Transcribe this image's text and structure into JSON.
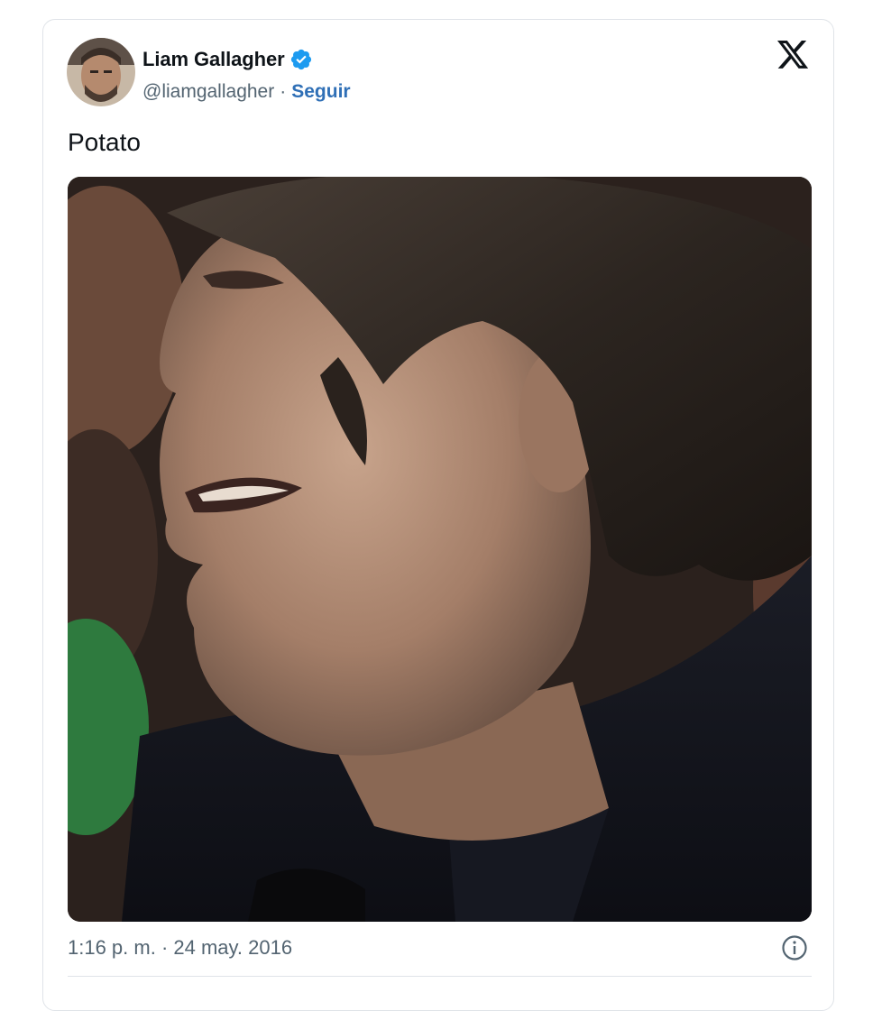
{
  "tweet": {
    "author": {
      "name": "Liam Gallagher",
      "handle": "@liamgallagher",
      "separator": "·",
      "follow_label": "Seguir",
      "verified": true,
      "avatar_icon": "avatar-photo"
    },
    "text": "Potato",
    "media": {
      "type": "photo",
      "icon": "photo-of-man-in-profile"
    },
    "timestamp": "1:16 p. m. · 24 may. 2016",
    "icons": {
      "platform_logo": "x-logo-icon",
      "verified": "verified-badge-icon",
      "info": "info-icon"
    }
  },
  "colors": {
    "text_primary": "#0f1419",
    "text_secondary": "#536471",
    "link": "#2f6fb6",
    "verified_badge": "#1d9bf0",
    "border": "#dfe3e8"
  }
}
